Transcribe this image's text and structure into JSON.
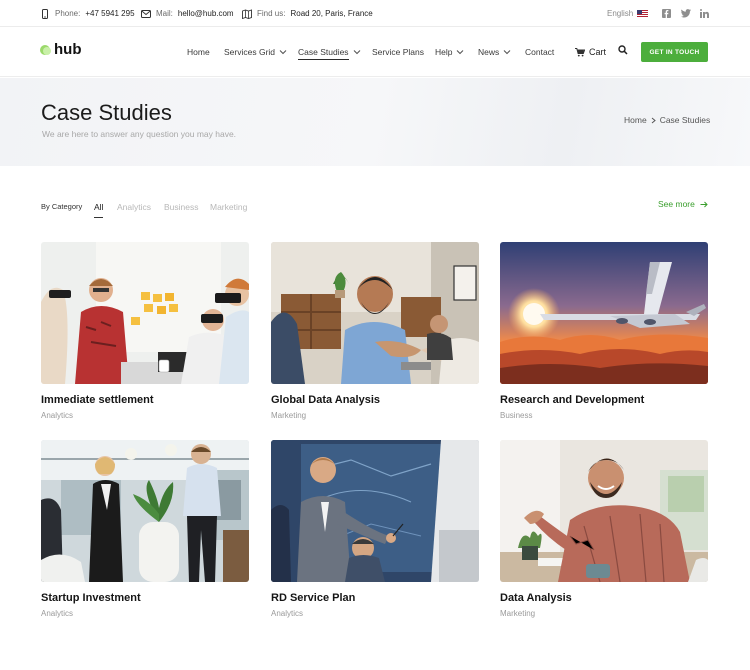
{
  "topbar": {
    "phone_label": "Phone:",
    "phone_value": "+47 5941 295",
    "mail_label": "Mail:",
    "mail_value": "hello@hub.com",
    "address_label": "Find us:",
    "address_value": "Road 20, Paris, France",
    "language": "English",
    "social": [
      "facebook-icon",
      "twitter-icon",
      "linkedin-icon"
    ]
  },
  "header": {
    "logo": "hub",
    "nav": [
      {
        "label": "Home",
        "dropdown": false,
        "active": false
      },
      {
        "label": "Services Grid",
        "dropdown": true,
        "active": false
      },
      {
        "label": "Case Studies",
        "dropdown": true,
        "active": true
      },
      {
        "label": "Service Plans",
        "dropdown": false,
        "active": false
      },
      {
        "label": "Help",
        "dropdown": true,
        "active": false
      },
      {
        "label": "News",
        "dropdown": true,
        "active": false
      },
      {
        "label": "Contact",
        "dropdown": false,
        "active": false
      }
    ],
    "cart_label": "Cart",
    "cta_label": "GET IN TOUCH",
    "accent_color": "#4cae3c"
  },
  "titlebar": {
    "title": "Case Studies",
    "subtitle": "We are here to answer any question you may have.",
    "breadcrumb": [
      "Home",
      "Case Studies"
    ]
  },
  "filters": {
    "label": "By Category",
    "items": [
      "All",
      "Analytics",
      "Business",
      "Marketing"
    ],
    "active": "All",
    "see_more": "See more"
  },
  "cards": [
    {
      "title": "Immediate settlement",
      "category": "Analytics"
    },
    {
      "title": "Global Data Analysis",
      "category": "Marketing"
    },
    {
      "title": "Research and Development",
      "category": "Business"
    },
    {
      "title": "Startup Investment",
      "category": "Analytics"
    },
    {
      "title": "RD Service Plan",
      "category": "Analytics"
    },
    {
      "title": "Data Analysis",
      "category": "Marketing"
    }
  ]
}
